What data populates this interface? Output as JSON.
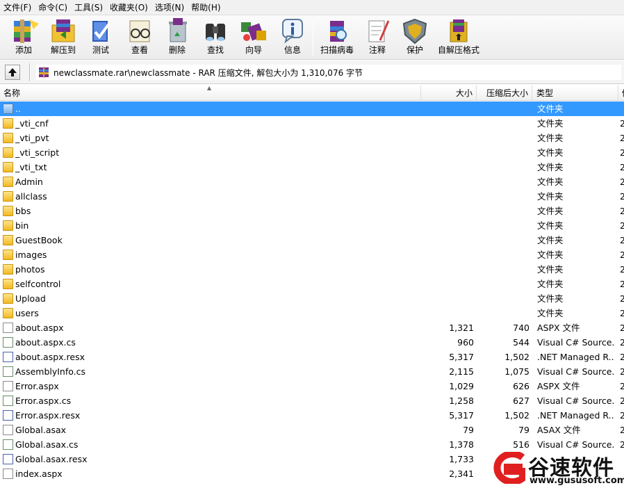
{
  "menu": [
    "文件(F)",
    "命令(C)",
    "工具(S)",
    "收藏夹(O)",
    "选项(N)",
    "帮助(H)"
  ],
  "toolbar": {
    "add": "添加",
    "extract": "解压到",
    "test": "测试",
    "view": "查看",
    "delete": "删除",
    "find": "查找",
    "wizard": "向导",
    "info": "信息",
    "scan": "扫描病毒",
    "comment": "注释",
    "protect": "保护",
    "sfx": "自解压格式"
  },
  "address": {
    "path": "newclassmate.rar\\newclassmate - RAR 压缩文件, 解包大小为 1,310,076 字节"
  },
  "columns": {
    "name": "名称",
    "size": "大小",
    "packed": "压缩后大小",
    "type": "类型",
    "modified": "修"
  },
  "files": [
    {
      "name": "..",
      "size": "",
      "packed": "",
      "type": "文件夹",
      "mod": "",
      "icon": "folder",
      "selected": true
    },
    {
      "name": "_vti_cnf",
      "size": "",
      "packed": "",
      "type": "文件夹",
      "mod": "2",
      "icon": "folder"
    },
    {
      "name": "_vti_pvt",
      "size": "",
      "packed": "",
      "type": "文件夹",
      "mod": "2",
      "icon": "folder"
    },
    {
      "name": "_vti_script",
      "size": "",
      "packed": "",
      "type": "文件夹",
      "mod": "2",
      "icon": "folder"
    },
    {
      "name": "_vti_txt",
      "size": "",
      "packed": "",
      "type": "文件夹",
      "mod": "2",
      "icon": "folder"
    },
    {
      "name": "Admin",
      "size": "",
      "packed": "",
      "type": "文件夹",
      "mod": "2",
      "icon": "folder"
    },
    {
      "name": "allclass",
      "size": "",
      "packed": "",
      "type": "文件夹",
      "mod": "2",
      "icon": "folder"
    },
    {
      "name": "bbs",
      "size": "",
      "packed": "",
      "type": "文件夹",
      "mod": "2",
      "icon": "folder"
    },
    {
      "name": "bin",
      "size": "",
      "packed": "",
      "type": "文件夹",
      "mod": "2",
      "icon": "folder"
    },
    {
      "name": "GuestBook",
      "size": "",
      "packed": "",
      "type": "文件夹",
      "mod": "2",
      "icon": "folder"
    },
    {
      "name": "images",
      "size": "",
      "packed": "",
      "type": "文件夹",
      "mod": "2",
      "icon": "folder"
    },
    {
      "name": "photos",
      "size": "",
      "packed": "",
      "type": "文件夹",
      "mod": "2",
      "icon": "folder"
    },
    {
      "name": "selfcontrol",
      "size": "",
      "packed": "",
      "type": "文件夹",
      "mod": "2",
      "icon": "folder"
    },
    {
      "name": "Upload",
      "size": "",
      "packed": "",
      "type": "文件夹",
      "mod": "2",
      "icon": "folder"
    },
    {
      "name": "users",
      "size": "",
      "packed": "",
      "type": "文件夹",
      "mod": "2",
      "icon": "folder"
    },
    {
      "name": "about.aspx",
      "size": "1,321",
      "packed": "740",
      "type": "ASPX 文件",
      "mod": "2",
      "icon": "file"
    },
    {
      "name": "about.aspx.cs",
      "size": "960",
      "packed": "544",
      "type": "Visual C# Source...",
      "mod": "2",
      "icon": "cs"
    },
    {
      "name": "about.aspx.resx",
      "size": "5,317",
      "packed": "1,502",
      "type": ".NET Managed R...",
      "mod": "2",
      "icon": "resx"
    },
    {
      "name": "AssemblyInfo.cs",
      "size": "2,115",
      "packed": "1,075",
      "type": "Visual C# Source...",
      "mod": "2",
      "icon": "cs"
    },
    {
      "name": "Error.aspx",
      "size": "1,029",
      "packed": "626",
      "type": "ASPX 文件",
      "mod": "2",
      "icon": "file"
    },
    {
      "name": "Error.aspx.cs",
      "size": "1,258",
      "packed": "627",
      "type": "Visual C# Source...",
      "mod": "2",
      "icon": "cs"
    },
    {
      "name": "Error.aspx.resx",
      "size": "5,317",
      "packed": "1,502",
      "type": ".NET Managed R...",
      "mod": "2",
      "icon": "resx"
    },
    {
      "name": "Global.asax",
      "size": "79",
      "packed": "79",
      "type": "ASAX 文件",
      "mod": "2",
      "icon": "file"
    },
    {
      "name": "Global.asax.cs",
      "size": "1,378",
      "packed": "516",
      "type": "Visual C# Source...",
      "mod": "2",
      "icon": "cs"
    },
    {
      "name": "Global.asax.resx",
      "size": "1,733",
      "packed": "",
      "type": "",
      "mod": "",
      "icon": "resx"
    },
    {
      "name": "index.aspx",
      "size": "2,341",
      "packed": "",
      "type": "",
      "mod": "",
      "icon": "file"
    }
  ],
  "watermark": {
    "brand": "谷速软件",
    "url": "www.gususoft.com"
  }
}
